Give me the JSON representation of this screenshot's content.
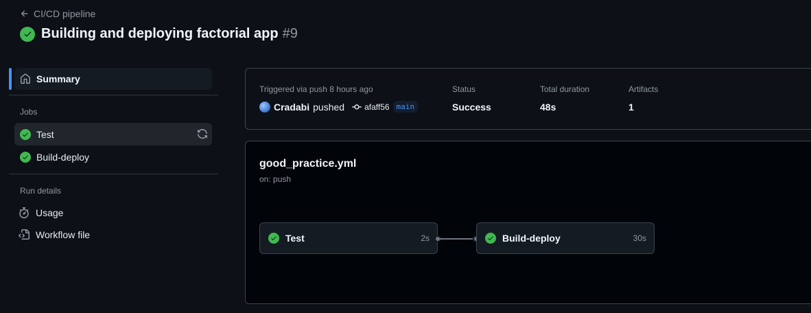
{
  "header": {
    "back_label": "CI/CD pipeline",
    "title": "Building and deploying factorial app",
    "run_number": "#9"
  },
  "sidebar": {
    "summary_label": "Summary",
    "jobs_section_label": "Jobs",
    "jobs": [
      {
        "label": "Test",
        "status": "success"
      },
      {
        "label": "Build-deploy",
        "status": "success"
      }
    ],
    "run_details_label": "Run details",
    "run_details": [
      {
        "label": "Usage",
        "icon": "stopwatch-icon"
      },
      {
        "label": "Workflow file",
        "icon": "file-code-icon"
      }
    ]
  },
  "summary": {
    "trigger_label": "Triggered via push 8 hours ago",
    "actor": "Cradabi",
    "action": "pushed",
    "commit": "afaff56",
    "branch": "main",
    "status_label": "Status",
    "status_value": "Success",
    "duration_label": "Total duration",
    "duration_value": "48s",
    "artifacts_label": "Artifacts",
    "artifacts_value": "1"
  },
  "workflow": {
    "file_name": "good_practice.yml",
    "trigger": "on: push",
    "nodes": [
      {
        "name": "Test",
        "duration": "2s"
      },
      {
        "name": "Build-deploy",
        "duration": "30s"
      }
    ]
  },
  "colors": {
    "background": "#0d1117",
    "success": "#3fb950",
    "accent": "#4493f8",
    "border": "#3d444d",
    "muted_text": "#9198a1"
  }
}
